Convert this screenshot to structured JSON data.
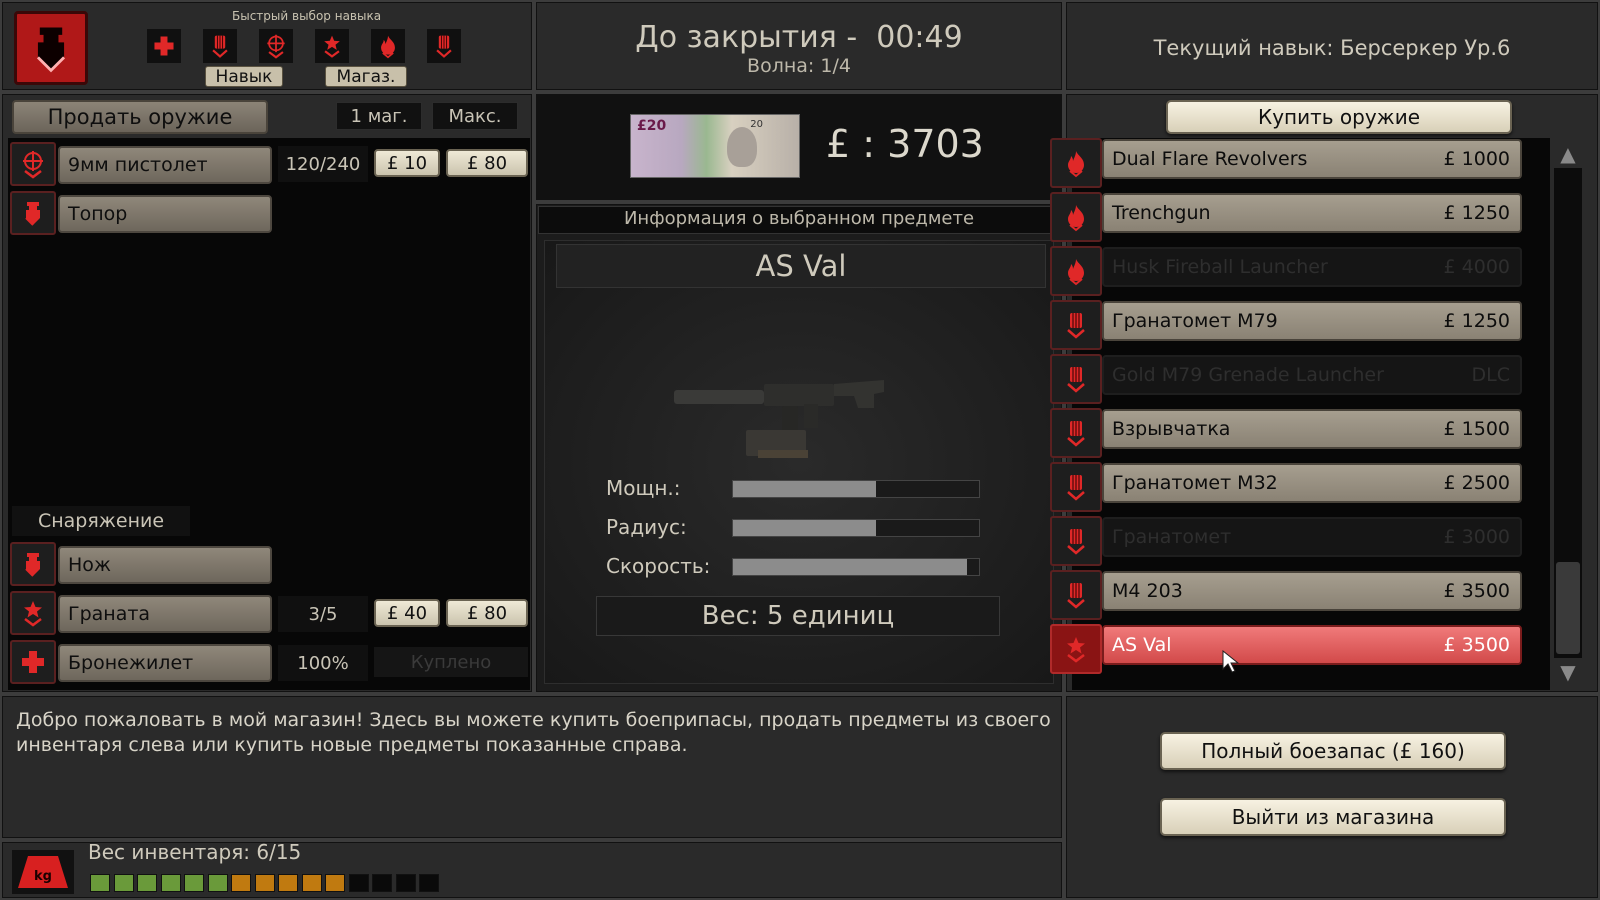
{
  "header": {
    "quick_skill_title": "Быстрый выбор навыка",
    "skill_tab": "Навык",
    "shop_tab": "Магаз.",
    "countdown_label": "До закрытия -  00:49",
    "wave_label": "Волна: 1/4",
    "current_skill": "Текущий навык: Берсеркер Ур.6"
  },
  "sell": {
    "title": "Продать оружие",
    "one_mag": "1 маг.",
    "max": "Макс.",
    "items": [
      {
        "name": "9мм пистолет",
        "ammo": "120/240",
        "mag_price": "£ 10",
        "max_price": "£ 80",
        "icon": "crosshair-icon"
      },
      {
        "name": "Топор",
        "icon": "fist-icon"
      }
    ],
    "equipment_title": "Снаряжение",
    "equipment": [
      {
        "name": "Нож",
        "icon": "fist-icon"
      },
      {
        "name": "Граната",
        "ammo": "3/5",
        "mag_price": "£ 40",
        "max_price": "£ 80",
        "icon": "star-icon"
      },
      {
        "name": "Бронежилет",
        "ammo": "100%",
        "status": "Куплено",
        "icon": "medic-cross-icon"
      }
    ]
  },
  "money": {
    "banknote_value": "£20",
    "banknote_corner": "20",
    "amount": "£ : 3703"
  },
  "info": {
    "title": "Информация о выбранном предмете",
    "item_name": "AS Val",
    "stats": [
      {
        "label": "Мощн.:",
        "value": 0.58
      },
      {
        "label": "Радиус:",
        "value": 0.58
      },
      {
        "label": "Скорость:",
        "value": 0.95
      }
    ],
    "weight": "Вес: 5 единиц"
  },
  "buy": {
    "title": "Купить оружие",
    "items": [
      {
        "name": "Dual Flare Revolvers",
        "price": "£ 1000",
        "state": "normal",
        "icon": "flame-icon"
      },
      {
        "name": "Trenchgun",
        "price": "£ 1250",
        "state": "normal",
        "icon": "flame-icon"
      },
      {
        "name": "Husk Fireball Launcher",
        "price": "£ 4000",
        "state": "dim",
        "icon": "flame-icon"
      },
      {
        "name": "Гранатомет M79",
        "price": "£ 1250",
        "state": "normal",
        "icon": "grenade-fist-icon"
      },
      {
        "name": "Gold M79 Grenade Launcher",
        "price": "DLC",
        "state": "dim",
        "icon": "grenade-fist-icon"
      },
      {
        "name": "Взрывчатка",
        "price": "£ 1500",
        "state": "normal",
        "icon": "grenade-fist-icon"
      },
      {
        "name": "Гранатомет M32",
        "price": "£ 2500",
        "state": "normal",
        "icon": "grenade-fist-icon"
      },
      {
        "name": "Гранатомет",
        "price": "£ 3000",
        "state": "dim",
        "icon": "grenade-fist-icon"
      },
      {
        "name": "M4 203",
        "price": "£ 3500",
        "state": "normal",
        "icon": "grenade-fist-icon"
      },
      {
        "name": "AS Val",
        "price": "£ 3500",
        "state": "selected",
        "icon": "star-icon"
      }
    ]
  },
  "message": "Добро пожаловать в мой магазин! Здесь вы можете купить боеприпасы, продать предметы из своего инвентаря слева или купить новые предметы показанные справа.",
  "actions": {
    "full_ammo": "Полный боезапас (£ 160)",
    "exit": "Выйти из магазина"
  },
  "inventory": {
    "weight_label": "Вес инвентаря: 6/15",
    "kg_label": "kg",
    "segments": [
      "#6a9a3a",
      "#6a9a3a",
      "#6a9a3a",
      "#6a9a3a",
      "#6a9a3a",
      "#6a9a3a",
      "#c07a10",
      "#c07a10",
      "#c07a10",
      "#c07a10",
      "#c07a10",
      "#0a0a0a",
      "#0a0a0a",
      "#0a0a0a",
      "#0a0a0a"
    ]
  },
  "colors": {
    "accent_red": "#e02828",
    "selected_row": "#e06060"
  }
}
